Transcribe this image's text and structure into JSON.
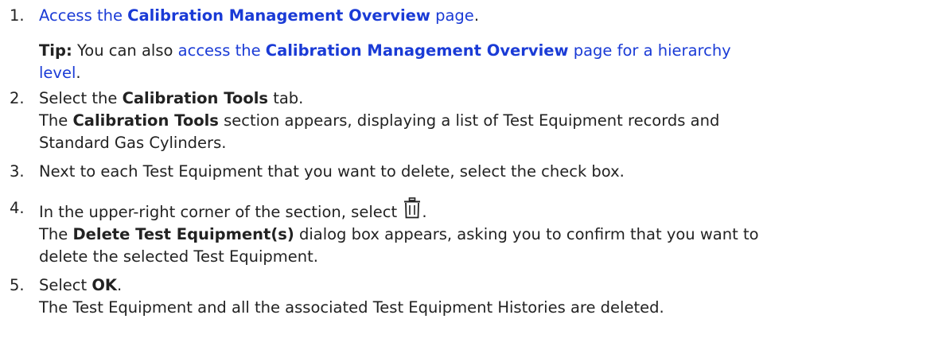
{
  "steps": [
    {
      "num": "1.",
      "link_pre": "Access the ",
      "link_bold": "Calibration Management Overview",
      "link_post": " page",
      "end": ".",
      "tip": {
        "label": "Tip:",
        "text": " You can also ",
        "link_pre": "access the ",
        "link_bold": "Calibration Management Overview",
        "link_post_1": " page for a hierarchy",
        "link_post_2": "level",
        "end": "."
      }
    },
    {
      "num": "2.",
      "pre": "Select the ",
      "bold": "Calibration Tools",
      "post": " tab.",
      "result_bold": "The ",
      "result_b": "Calibration Tools",
      "result_1": " section appears, displaying a list of Test Equipment records and",
      "result_2": "Standard Gas Cylinders."
    },
    {
      "num": "3.",
      "text": "Next to each Test Equipment that you want to delete, select the check box."
    },
    {
      "num": "4.",
      "pre": "In the upper-right corner of the section, select ",
      "icon": "trash-icon",
      "post": ".",
      "result_pre": "The ",
      "result_b": "Delete Test Equipment(s)",
      "result_1": " dialog box appears, asking you to confirm that you want to",
      "result_2": "delete the selected Test Equipment."
    },
    {
      "num": "5.",
      "pre": "Select ",
      "bold": "OK",
      "post": ".",
      "result": "The Test Equipment and all the associated Test Equipment Histories are deleted."
    }
  ],
  "colors": {
    "link": "#1a3bd6",
    "text": "#222222"
  }
}
